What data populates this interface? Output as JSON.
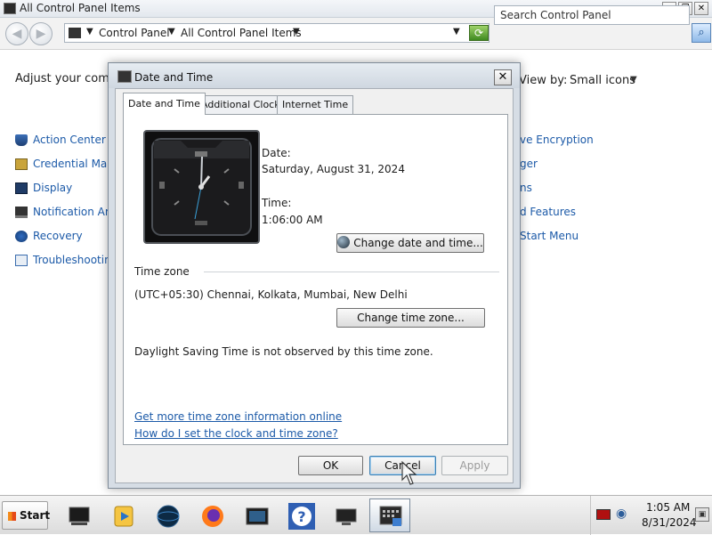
{
  "control_panel": {
    "window_title": "All Control Panel Items",
    "breadcrumb": [
      "Control Panel",
      "All Control Panel Items"
    ],
    "search_placeholder": "Search Control Panel",
    "adjust_text": "Adjust your compu",
    "view_by_label": "View by:",
    "view_by_value": "Small icons",
    "items_left": [
      "Action Center",
      "Credential Mana",
      "Display",
      "Notification Are",
      "Recovery",
      "Troubleshootin"
    ],
    "items_right": [
      "ve Encryption",
      "ger",
      "ns",
      "d Features",
      "Start Menu"
    ]
  },
  "dialog": {
    "title": "Date and Time",
    "tabs": [
      "Date and Time",
      "Additional Clocks",
      "Internet Time"
    ],
    "date_label": "Date:",
    "date_value": "Saturday, August 31, 2024",
    "time_label": "Time:",
    "time_value": "1:06:00 AM",
    "change_date_button": "Change date and time...",
    "timezone_label": "Time zone",
    "timezone_value": "(UTC+05:30) Chennai, Kolkata, Mumbai, New Delhi",
    "change_timezone_button": "Change time zone...",
    "dst_text": "Daylight Saving Time is not observed by this time zone.",
    "link_more_info": "Get more time zone information online",
    "link_how_to": "How do I set the clock and time zone?",
    "ok_button": "OK",
    "cancel_button": "Cancel",
    "apply_button": "Apply"
  },
  "taskbar": {
    "start_label": "Start",
    "clock_time": "1:05 AM",
    "clock_date": "8/31/2024"
  }
}
